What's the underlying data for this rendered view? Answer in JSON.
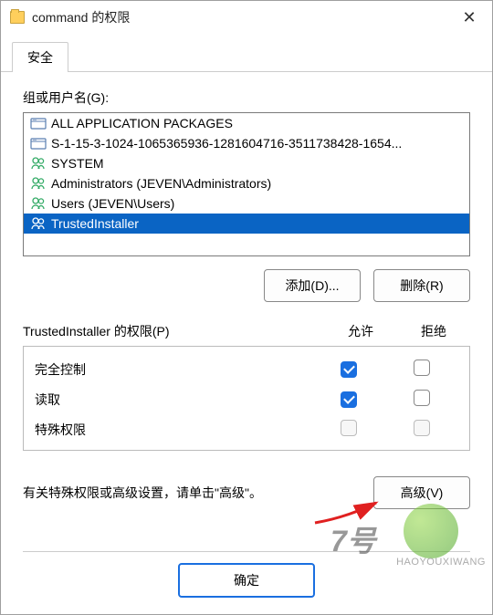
{
  "titlebar": {
    "title": "command 的权限"
  },
  "tabs": {
    "security": "安全"
  },
  "groups_label": "组或用户名(G):",
  "users": [
    {
      "name": "ALL APPLICATION PACKAGES",
      "icon": "package"
    },
    {
      "name": "S-1-15-3-1024-1065365936-1281604716-3511738428-1654...",
      "icon": "package"
    },
    {
      "name": "SYSTEM",
      "icon": "users"
    },
    {
      "name": "Administrators (JEVEN\\Administrators)",
      "icon": "users"
    },
    {
      "name": "Users (JEVEN\\Users)",
      "icon": "users"
    },
    {
      "name": "TrustedInstaller",
      "icon": "users",
      "selected": true
    }
  ],
  "buttons": {
    "add": "添加(D)...",
    "remove": "删除(R)",
    "advanced": "高级(V)",
    "ok": "确定"
  },
  "permissions": {
    "title": "TrustedInstaller 的权限(P)",
    "allow_col": "允许",
    "deny_col": "拒绝",
    "rows": [
      {
        "name": "完全控制",
        "allow": true,
        "deny": false
      },
      {
        "name": "读取",
        "allow": true,
        "deny": false
      },
      {
        "name": "特殊权限",
        "allow": false,
        "deny": false,
        "disabled": true
      }
    ]
  },
  "advanced_text": "有关特殊权限或高级设置，请单击\"高级\"。",
  "watermark": {
    "text": "7号",
    "sub": "HAOYOUXIWANG"
  }
}
